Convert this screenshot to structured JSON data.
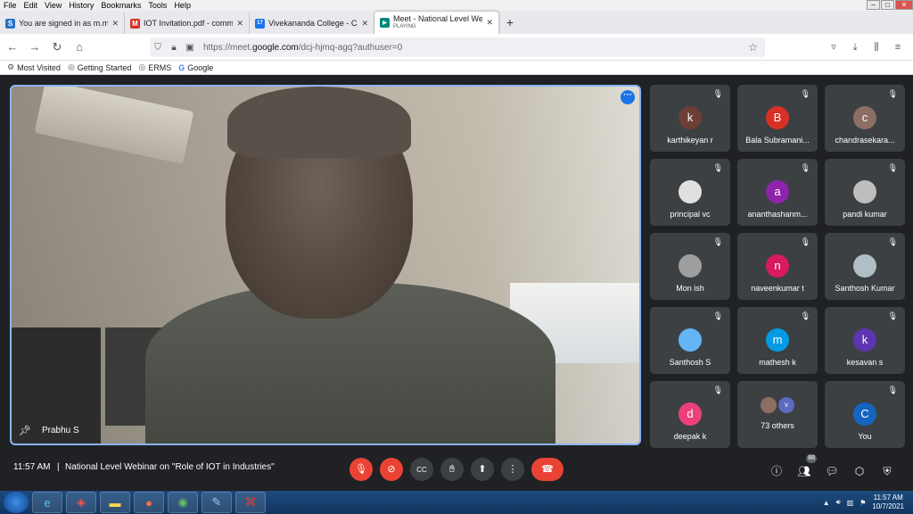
{
  "menubar": {
    "items": [
      "File",
      "Edit",
      "View",
      "History",
      "Bookmarks",
      "Tools",
      "Help"
    ]
  },
  "window_controls": {
    "minimize": "–",
    "maximize": "□",
    "close": "✕"
  },
  "tabs": [
    {
      "title": "You are signed in as m.mohan",
      "favicon": "S",
      "favicon_color": "#2b73c8"
    },
    {
      "title": "IOT Invitation.pdf - commerce",
      "favicon": "M",
      "favicon_color": "#d93025"
    },
    {
      "title": "Vivekananda College - Calenda",
      "favicon": "17",
      "favicon_color": "#1a73e8"
    },
    {
      "title": "Meet - National Level Webinar",
      "subtitle": "PLAYING",
      "favicon": "▶",
      "favicon_color": "#00897b"
    }
  ],
  "navbar": {
    "url_prefix": "https://meet.",
    "url_domain": "google.com",
    "url_suffix": "/dcj-hjmq-agq?authuser=0"
  },
  "bookmarks": [
    "Most Visited",
    "Getting Started",
    "ERMS",
    "Google"
  ],
  "main_video": {
    "name": "Prabhu S"
  },
  "participants": [
    {
      "name": "karthikeyan r",
      "initial": "k",
      "color": "#6d3f36"
    },
    {
      "name": "Bala Subramani...",
      "initial": "B",
      "color": "#d93025"
    },
    {
      "name": "chandrasekara...",
      "initial": "c",
      "color": "#8d6e63"
    },
    {
      "name": "principal vc",
      "initial": "",
      "color": "#e0e0e0"
    },
    {
      "name": "ananthashanm...",
      "initial": "a",
      "color": "#8e24aa"
    },
    {
      "name": "pandi kumar",
      "initial": "",
      "color": "#bdbdbd"
    },
    {
      "name": "Mon ish",
      "initial": "",
      "color": "#9e9e9e"
    },
    {
      "name": "naveenkumar t",
      "initial": "n",
      "color": "#d81b60"
    },
    {
      "name": "Santhosh Kumar",
      "initial": "",
      "color": "#b0bec5"
    },
    {
      "name": "Santhosh S",
      "initial": "",
      "color": "#64b5f6"
    },
    {
      "name": "mathesh k",
      "initial": "m",
      "color": "#039be5"
    },
    {
      "name": "kesavan s",
      "initial": "k",
      "color": "#5e35b1"
    },
    {
      "name": "deepak k",
      "initial": "d",
      "color": "#ec407a"
    },
    {
      "name": "73 others",
      "initial": "v",
      "color": "#5c6bc0",
      "others": true
    },
    {
      "name": "You",
      "initial": "C",
      "color": "#1565c0"
    }
  ],
  "controls": {
    "time": "11:57 AM",
    "separator": "|",
    "meeting_title": "National Level Webinar on \"Role of IOT in Industries\"",
    "participant_count": "88"
  },
  "taskbar": {
    "time": "11:57 AM",
    "date": "10/7/2021"
  }
}
